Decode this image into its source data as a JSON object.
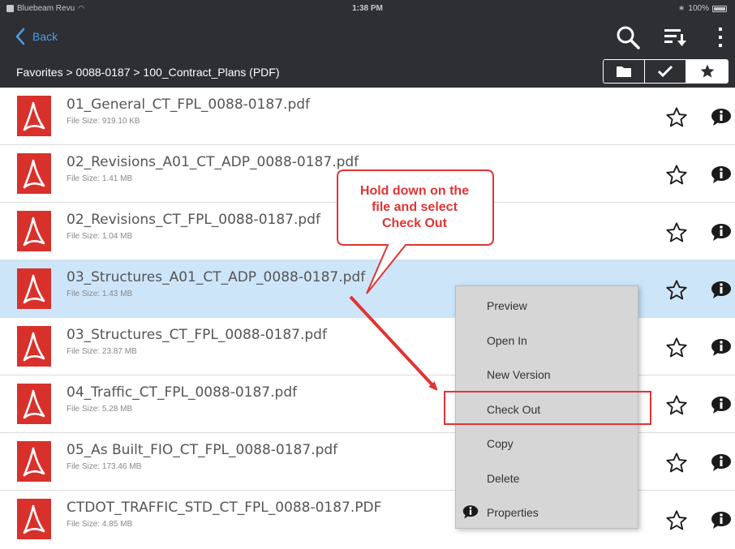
{
  "status_bar": {
    "app_name": "Bluebeam Revu",
    "time": "1:38 PM",
    "battery": "100%"
  },
  "nav": {
    "back_label": "Back",
    "icons": [
      "search-icon",
      "sort-icon",
      "more-vertical-icon"
    ]
  },
  "breadcrumb": {
    "text": "Favorites > 0088-0187 > 100_Contract_Plans (PDF)"
  },
  "view_toggle": {
    "options": [
      "folder-icon",
      "check-icon",
      "star-icon"
    ],
    "active": "star-icon"
  },
  "files": [
    {
      "name": "01_General_CT_FPL_0088-0187.pdf",
      "size": "File Size: 919.10 KB"
    },
    {
      "name": "02_Revisions_A01_CT_ADP_0088-0187.pdf",
      "size": "File Size: 1.41 MB"
    },
    {
      "name": "02_Revisions_CT_FPL_0088-0187.pdf",
      "size": "File Size: 1.04 MB"
    },
    {
      "name": "03_Structures_A01_CT_ADP_0088-0187.pdf",
      "size": "File Size: 1.43 MB"
    },
    {
      "name": "03_Structures_CT_FPL_0088-0187.pdf",
      "size": "File Size: 23.87 MB"
    },
    {
      "name": "04_Traffic_CT_FPL_0088-0187.pdf",
      "size": "File Size: 5.28 MB"
    },
    {
      "name": "05_As Built_FIO_CT_FPL_0088-0187.pdf",
      "size": "File Size: 173.46 MB"
    },
    {
      "name": "CTDOT_TRAFFIC_STD_CT_FPL_0088-0187.PDF",
      "size": "File Size: 4.85 MB"
    }
  ],
  "selected_file_index": 3,
  "callout": {
    "line1": "Hold down on the",
    "line2": "file and select",
    "line3": "Check Out"
  },
  "context_menu": {
    "items": [
      "Preview",
      "Open In",
      "New Version",
      "Check Out",
      "Copy",
      "Delete",
      "Properties"
    ],
    "highlighted": "Check Out"
  },
  "colors": {
    "dark_bar": "#2d2f33",
    "accent_blue": "#4a9ee8",
    "selected_row": "#cde5f9",
    "annotation_red": "#e03434",
    "pdf_red": "#d8312b"
  }
}
